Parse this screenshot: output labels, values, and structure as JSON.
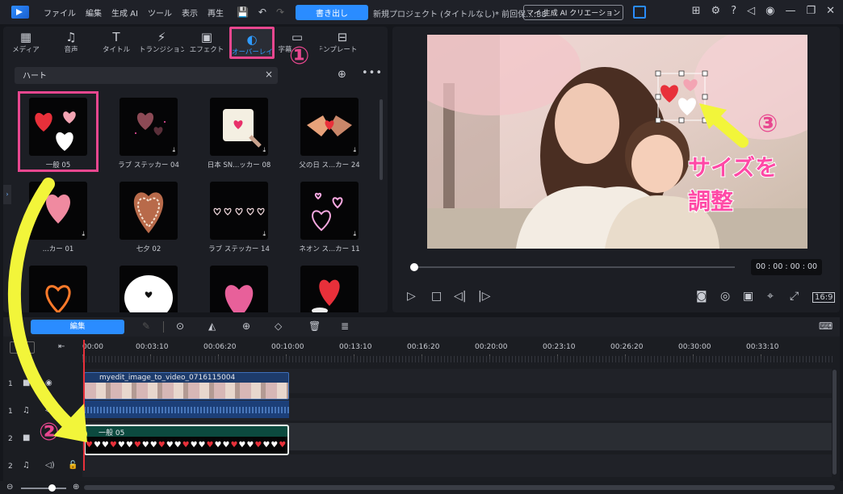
{
  "titlebar": {
    "menu": [
      "ファイル",
      "編集",
      "生成 AI",
      "ツール",
      "表示",
      "再生"
    ],
    "export_label": "書き出し",
    "project_title": "新規プロジェクト (タイトルなし)* 前回保...:38",
    "ai_creation_label": "マイ 生成 AI クリエーション"
  },
  "tabs": [
    {
      "label": "メディア",
      "icon": "media-icon"
    },
    {
      "label": "音声",
      "icon": "music-icon"
    },
    {
      "label": "タイトル",
      "icon": "title-icon"
    },
    {
      "label": "トランジション",
      "icon": "transition-icon"
    },
    {
      "label": "エフェクト",
      "icon": "effect-icon"
    },
    {
      "label": "オーバーレイ",
      "icon": "overlay-icon"
    },
    {
      "label": "字幕",
      "icon": "subtitle-icon"
    },
    {
      "label": "テンプレート",
      "icon": "template-icon"
    }
  ],
  "search": {
    "value": "ハート",
    "placeholder": ""
  },
  "items": [
    {
      "label": "一般 05"
    },
    {
      "label": "ラブ ステッカー 04"
    },
    {
      "label": "日本 SN...ッカー 08"
    },
    {
      "label": "父の日 ス...カー 24"
    },
    {
      "label": "...カー 01"
    },
    {
      "label": "七夕 02"
    },
    {
      "label": "ラブ ステッカー 14"
    },
    {
      "label": "ネオン ス...カー 11"
    },
    {
      "label": ""
    },
    {
      "label": ""
    },
    {
      "label": ""
    },
    {
      "label": ""
    }
  ],
  "preview": {
    "timecode": "00 : 00 : 00 : 00",
    "progress": 0.0
  },
  "timeline": {
    "edit_tab": "編集",
    "ticks": [
      "00:00",
      "00:03:10",
      "00:06:20",
      "00:10:00",
      "00:13:10",
      "00:16:20",
      "00:20:00",
      "00:23:10",
      "00:26:20",
      "00:30:00",
      "00:33:10"
    ],
    "tracks": [
      {
        "num": "1",
        "type": "video"
      },
      {
        "num": "1",
        "type": "audio"
      },
      {
        "num": "2",
        "type": "video"
      },
      {
        "num": "2",
        "type": "audio"
      }
    ],
    "clip_video_name": "myedit_image_to_video_0716115004",
    "clip_overlay_name": "一般 05"
  },
  "annotations": {
    "step1": "①",
    "step2": "②",
    "step3": "③",
    "note_line1": "サイズを",
    "note_line2": "調整"
  },
  "colors": {
    "accent": "#2a8cff",
    "highlight": "#e8478f",
    "arrow": "#f2f53a"
  }
}
